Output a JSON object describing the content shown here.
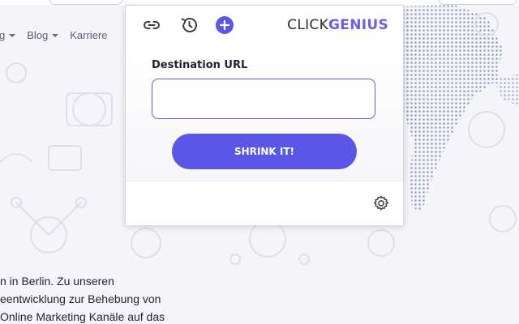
{
  "background": {
    "nav": [
      {
        "label": "g"
      },
      {
        "label": "Blog"
      },
      {
        "label": "Karriere"
      }
    ],
    "text_lines": [
      "n in Berlin. Zu unseren",
      "eentwicklung zur Behebung von",
      "Online Marketing Kanäle auf das"
    ]
  },
  "popup": {
    "toolbar": {
      "icons": [
        "link-icon",
        "history-icon",
        "add-icon"
      ],
      "logo_part1": "CLICK",
      "logo_part2": "GENIUS"
    },
    "form": {
      "label": "Destination URL",
      "url_value": "",
      "url_placeholder": "",
      "button_label": "SHRINK IT!"
    },
    "footer": {
      "icons": [
        "gear-icon"
      ]
    }
  },
  "colors": {
    "accent": "#5b57e6",
    "logo_accent": "#6a5df0",
    "page_bg": "#f4f4f9",
    "map_dots": "#6b7fa8"
  }
}
